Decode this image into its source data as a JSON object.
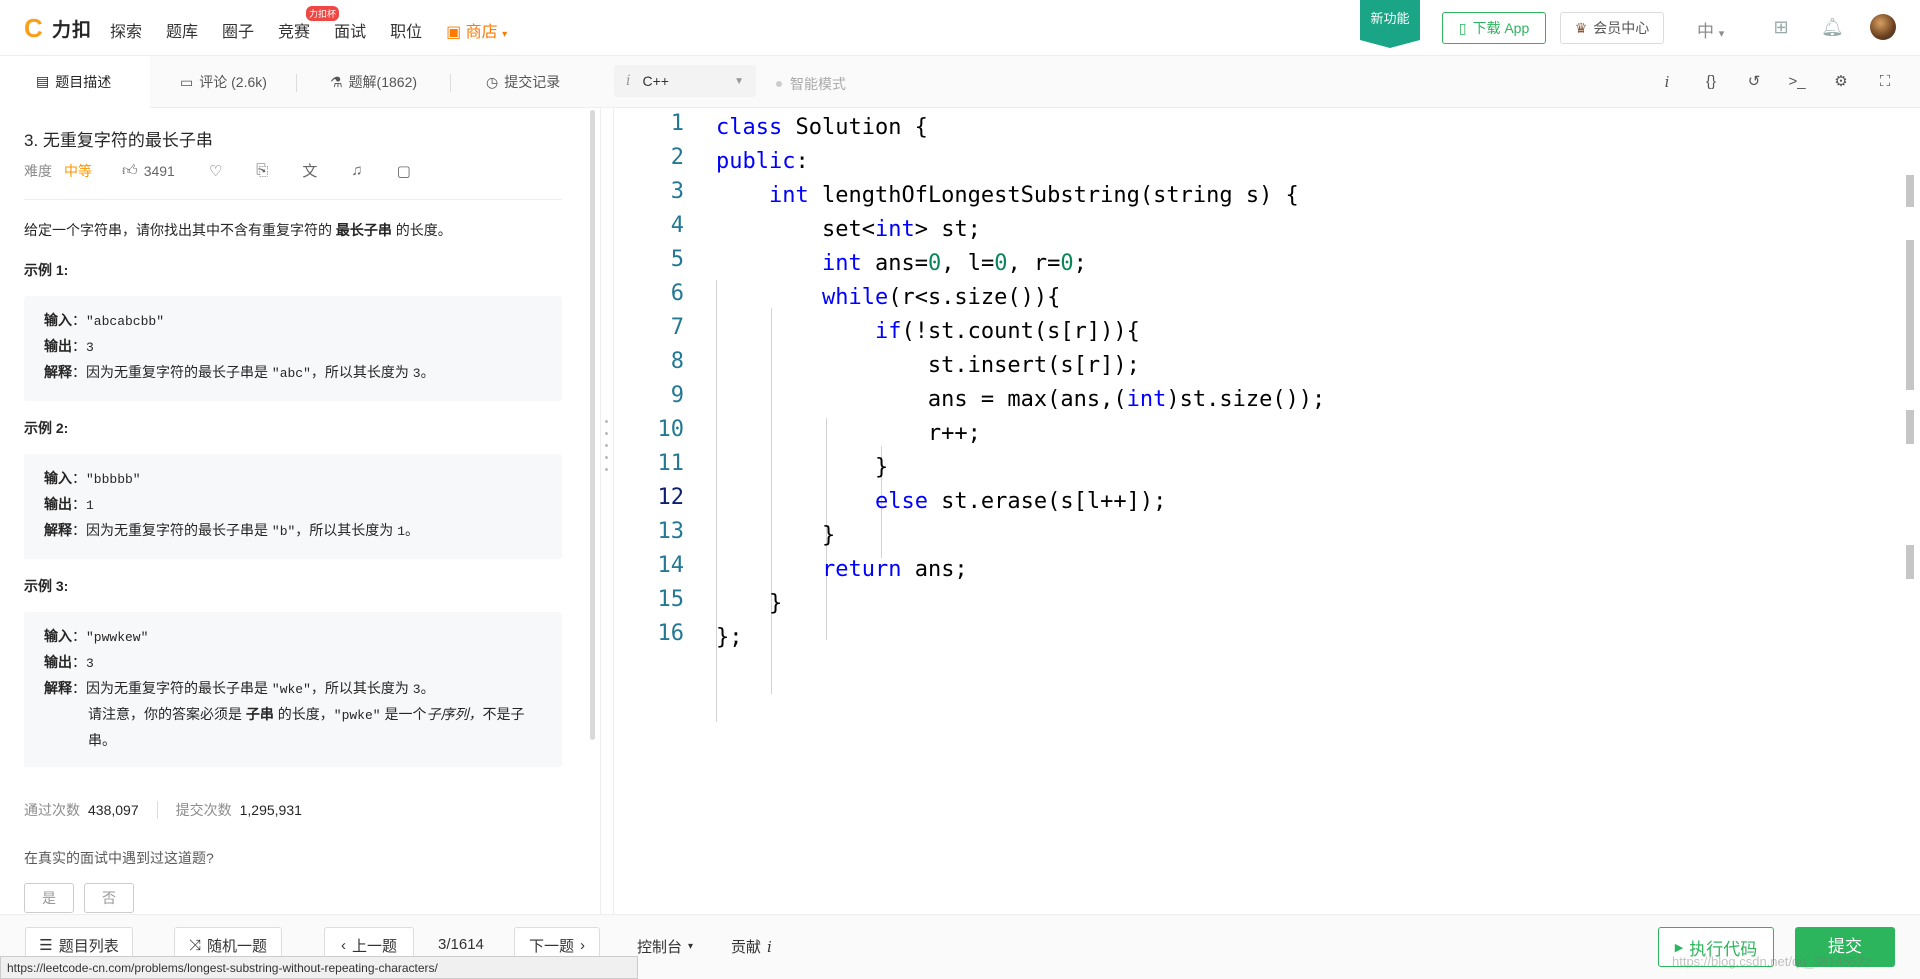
{
  "nav": {
    "logo_text": "力扣",
    "items": [
      "探索",
      "题库",
      "圈子",
      "竞赛",
      "面试",
      "职位"
    ],
    "contest_badge": "力扣杯",
    "shop": "商店",
    "new_feature": "新功能",
    "download_app": "下载 App",
    "vip_center": "会员中心",
    "language": "中"
  },
  "tabs": {
    "description": "题目描述",
    "comments": "评论 (2.6k)",
    "solutions": "题解(1862)",
    "submissions": "提交记录"
  },
  "editor_bar": {
    "language": "C++",
    "smart_mode": "智能模式"
  },
  "problem": {
    "title": "3. 无重复字符的最长子串",
    "difficulty_label": "难度",
    "difficulty": "中等",
    "likes": "3491",
    "desc_prefix": "给定一个字符串，请你找出其中不含有重复字符的 ",
    "desc_bold": "最长子串",
    "desc_suffix": " 的长度。",
    "examples": [
      {
        "label": "示例 1:",
        "input_key": "输入",
        "input": "\"abcabcbb\"",
        "output_key": "输出",
        "output": "3",
        "explain_key": "解释",
        "explain_pre": "因为无重复字符的最长子串是 ",
        "explain_code": "\"abc\"",
        "explain_mid": "，所以其长度为 ",
        "explain_num": "3",
        "explain_end": "。"
      },
      {
        "label": "示例 2:",
        "input_key": "输入",
        "input": "\"bbbbb\"",
        "output_key": "输出",
        "output": "1",
        "explain_key": "解释",
        "explain_pre": "因为无重复字符的最长子串是 ",
        "explain_code": "\"b\"",
        "explain_mid": "，所以其长度为 ",
        "explain_num": "1",
        "explain_end": "。"
      },
      {
        "label": "示例 3:",
        "input_key": "输入",
        "input": "\"pwwkew\"",
        "output_key": "输出",
        "output": "3",
        "explain_key": "解释",
        "explain_pre": "因为无重复字符的最长子串是 ",
        "explain_code": "\"wke\"",
        "explain_mid": "，所以其长度为 ",
        "explain_num": "3",
        "explain_end": "。",
        "note_pre": "请注意，你的答案必须是 ",
        "note_bold": "子串",
        "note_mid": " 的长度，",
        "note_code": "\"pwke\"",
        "note_mid2": " 是一个",
        "note_ital": "子序列，",
        "note_end": "不是子串。"
      }
    ],
    "accepted_label": "通过次数",
    "accepted": "438,097",
    "submitted_label": "提交次数",
    "submitted": "1,295,931",
    "interview_question": "在真实的面试中遇到过这道题?",
    "yes": "是",
    "no": "否"
  },
  "code": {
    "line_numbers": [
      "1",
      "2",
      "3",
      "4",
      "5",
      "6",
      "7",
      "8",
      "9",
      "10",
      "11",
      "12",
      "13",
      "14",
      "15",
      "16"
    ],
    "current_line": "12"
  },
  "bottom": {
    "problem_list": "题目列表",
    "random": "随机一题",
    "prev": "上一题",
    "page": "3/1614",
    "next": "下一题",
    "console": "控制台",
    "contribute": "贡献",
    "run": "执行代码",
    "submit": "提交"
  },
  "status_url": "https://leetcode-cn.com/problems/longest-substring-without-repeating-characters/",
  "watermark": "https://blog.csdn.net/qq_38145522",
  "colors": {
    "accent_green": "#2db55d",
    "difficulty_orange": "#ff9500",
    "keyword_blue": "#0000ff",
    "number_green": "#098658",
    "line_number": "#237893"
  }
}
